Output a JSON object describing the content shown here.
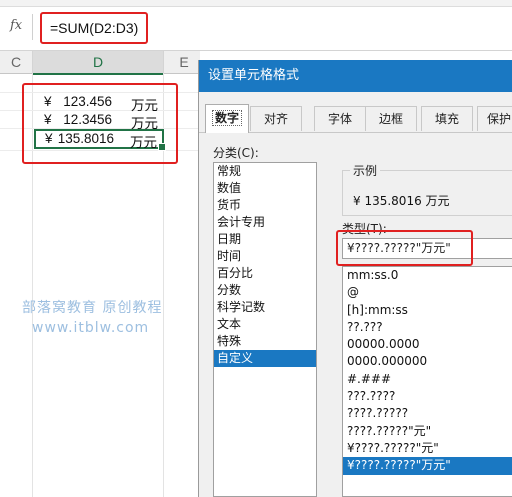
{
  "formula_bar": {
    "fx_label": "fx",
    "formula": "=SUM(D2:D3)"
  },
  "sheet": {
    "columns": [
      "C",
      "D",
      "E"
    ],
    "cells": [
      {
        "currency": "¥",
        "number": "123.456",
        "unit": "万元"
      },
      {
        "currency": "¥",
        "number": "12.3456",
        "unit": "万元"
      },
      {
        "currency": "¥",
        "number": "135.8016",
        "unit": "万元"
      }
    ],
    "watermark": {
      "line1": "部落窝教育  原创教程",
      "line2": "www.itblw.com"
    }
  },
  "dialog": {
    "title": "设置单元格格式",
    "tabs": [
      "数字",
      "对齐",
      "字体",
      "边框",
      "填充",
      "保护"
    ],
    "active_tab": "数字",
    "category_label": "分类(C):",
    "categories": [
      "常规",
      "数值",
      "货币",
      "会计专用",
      "日期",
      "时间",
      "百分比",
      "分数",
      "科学记数",
      "文本",
      "特殊",
      "自定义"
    ],
    "selected_category": "自定义",
    "sample_label": "示例",
    "sample_value": "¥ 135.8016 万元",
    "type_label": "类型(T):",
    "type_value": "¥????.?????\"万元\"",
    "formats": [
      "mm:ss.0",
      "@",
      "[h]:mm:ss",
      "??.???",
      "00000.0000",
      "0000.000000",
      "#.###",
      "???.????",
      "????.?????",
      "????.?????\"元\"",
      "¥????.?????\"元\"",
      "¥????.?????\"万元\""
    ],
    "selected_format": "¥????.?????\"万元\""
  },
  "colors": {
    "accent": "#1a78c2",
    "highlight_box": "#e02020",
    "excel_green": "#217346"
  }
}
